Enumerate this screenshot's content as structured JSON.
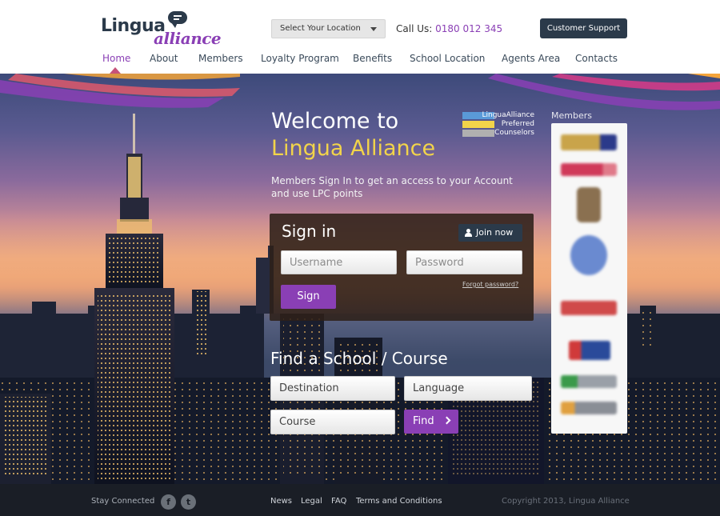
{
  "brand": {
    "logo_word1": "Lingua",
    "logo_word2": "alliance",
    "accent": "#8a3fb5",
    "dark": "#2b3a4a"
  },
  "header": {
    "location_select": "Select Your Location",
    "call_label": "Call Us:",
    "phone": "0180 012 345",
    "support_button": "Customer Support"
  },
  "nav": {
    "items": [
      {
        "label": "Home"
      },
      {
        "label": "About"
      },
      {
        "label": "Members"
      },
      {
        "label": "Loyalty Program"
      },
      {
        "label": "Benefits"
      },
      {
        "label": "School Location"
      },
      {
        "label": "Agents Area"
      },
      {
        "label": "Contacts"
      }
    ],
    "active": "Home"
  },
  "hero": {
    "welcome_line1": "Welcome to",
    "welcome_line2": "Lingua Alliance",
    "intro": "Members Sign In to get an access to your Account and use LPC points",
    "badge": {
      "line1": "LinguaAlliance",
      "line2": "Preferred",
      "line3": "Counselors"
    }
  },
  "signin": {
    "title": "Sign in",
    "join_button": "Join now",
    "username_placeholder": "Username",
    "password_placeholder": "Password",
    "forgot": "Forgot password?",
    "sign_button": "Sign"
  },
  "find": {
    "title": "Find a School / Course",
    "destination": "Destination",
    "language": "Language",
    "course": "Course",
    "find_button": "Find"
  },
  "members": {
    "label": "Members"
  },
  "footer": {
    "stay_connected": "Stay Connected",
    "links": [
      "News",
      "Legal",
      "FAQ",
      "Terms and Conditions"
    ],
    "copyright": "Copyright 2013, Lingua Alliance"
  }
}
